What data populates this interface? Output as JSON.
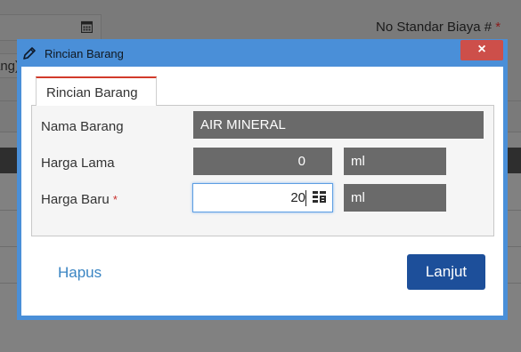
{
  "background": {
    "standard_cost_label": "No Standar Biaya #",
    "required_mark": "*",
    "partial_field_text": "ang)"
  },
  "modal": {
    "title": "Rincian Barang",
    "close_label": "×",
    "tab_label": "Rincian Barang",
    "fields": {
      "item_name_label": "Nama Barang",
      "item_name_value": "AIR MINERAL",
      "old_price_label": "Harga Lama",
      "old_price_value": "0",
      "old_price_unit": "ml",
      "new_price_label": "Harga Baru",
      "new_price_required": "*",
      "new_price_value": "20",
      "new_price_unit": "ml"
    },
    "delete_link": "Hapus",
    "continue_button": "Lanjut"
  },
  "icons": {
    "title_icon": "pencil-icon",
    "calendar_icon": "calendar-icon",
    "input_icon": "calculator-icon"
  },
  "colors": {
    "modal_frame": "#4a8fd8",
    "close_button": "#cd4f4a",
    "primary_button": "#1d4f9a",
    "link": "#3a85c3",
    "tab_accent": "#d23b2b",
    "readonly_field": "#6a6a6a"
  }
}
